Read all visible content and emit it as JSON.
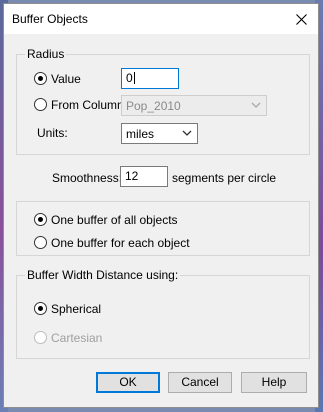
{
  "window": {
    "title": "Buffer Objects"
  },
  "radius": {
    "group_label": "Radius",
    "value_option": "Value",
    "value_input": "0",
    "from_column_option": "From Column",
    "column_select": "Pop_2010",
    "units_label": "Units:",
    "units_select": "miles"
  },
  "smoothness": {
    "label": "Smoothness:",
    "value": "12",
    "suffix": "segments per circle"
  },
  "buffer_mode": {
    "all_objects": "One buffer of all objects",
    "each_object": "One buffer for each object"
  },
  "distance": {
    "group_label": "Buffer Width Distance using:",
    "spherical": "Spherical",
    "cartesian": "Cartesian"
  },
  "buttons": {
    "ok": "OK",
    "cancel": "Cancel",
    "help": "Help"
  },
  "colors": {
    "accent": "#0078d7",
    "dialog_bg": "#f0f0f0"
  }
}
